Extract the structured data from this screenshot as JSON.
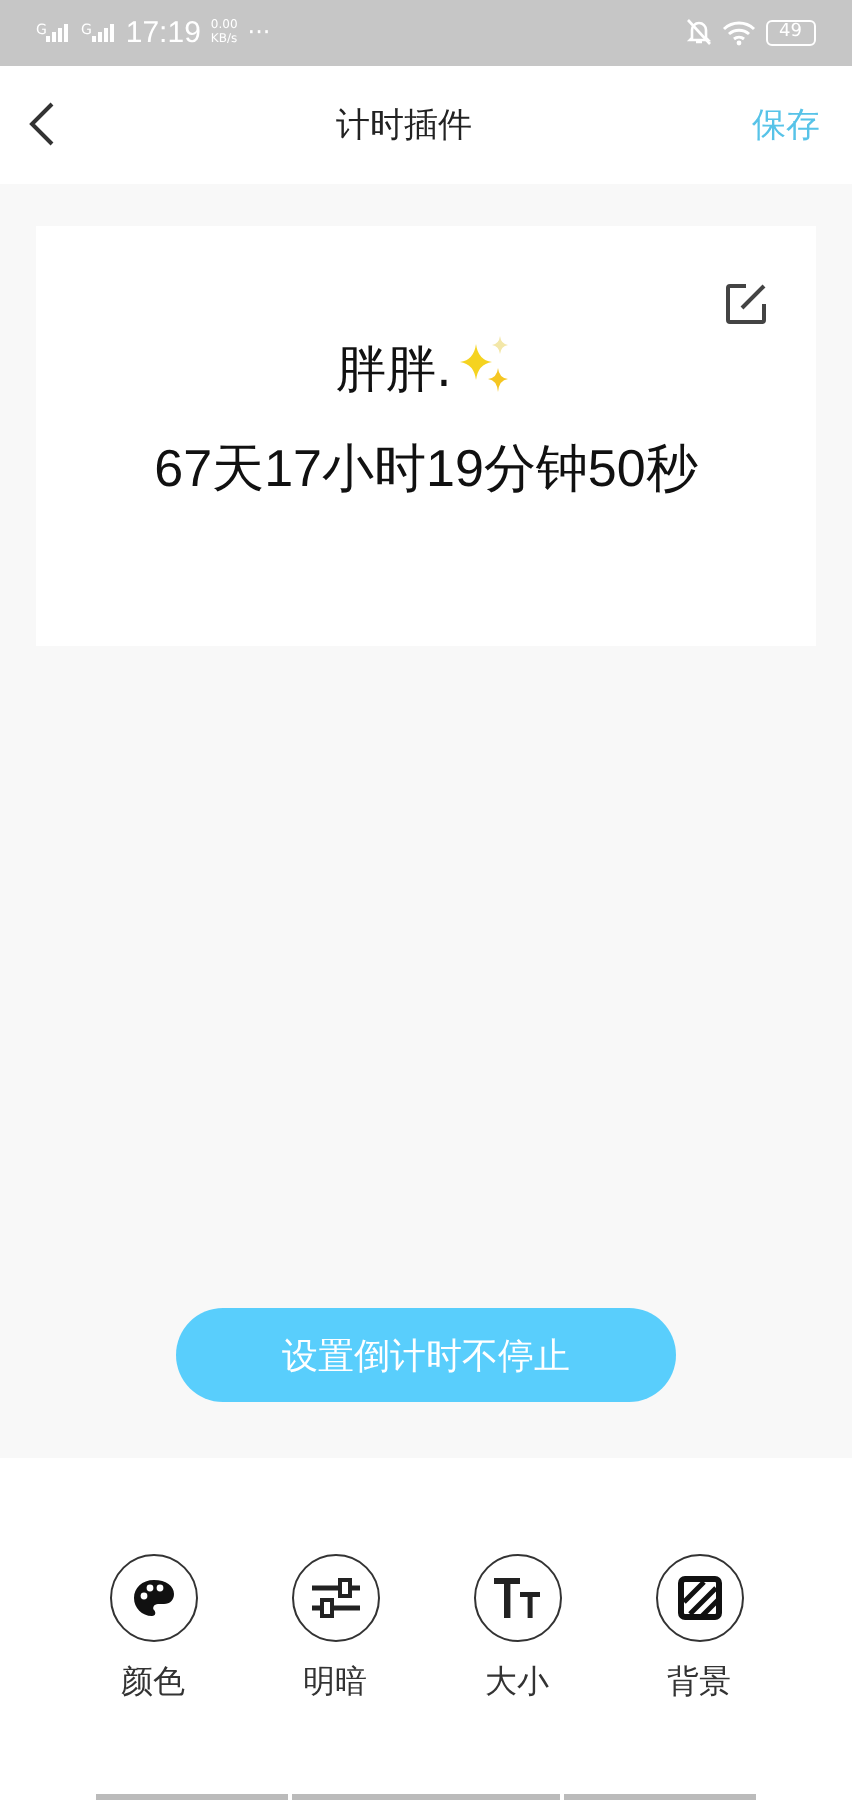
{
  "status_bar": {
    "signals": [
      {
        "label": "G"
      },
      {
        "label": "G"
      }
    ],
    "time": "17:19",
    "speed_value": "0.00",
    "speed_unit": "KB/s",
    "more": "···",
    "battery": "49"
  },
  "header": {
    "title": "计时插件",
    "action": "保存"
  },
  "widget": {
    "name": "胖胖.",
    "countdown": "67天17小时19分钟50秒"
  },
  "primary_button": "设置倒计时不停止",
  "tools": [
    {
      "kind": "palette",
      "label": "颜色"
    },
    {
      "kind": "sliders",
      "label": "明暗"
    },
    {
      "kind": "textsize",
      "label": "大小"
    },
    {
      "kind": "background",
      "label": "背景"
    }
  ]
}
